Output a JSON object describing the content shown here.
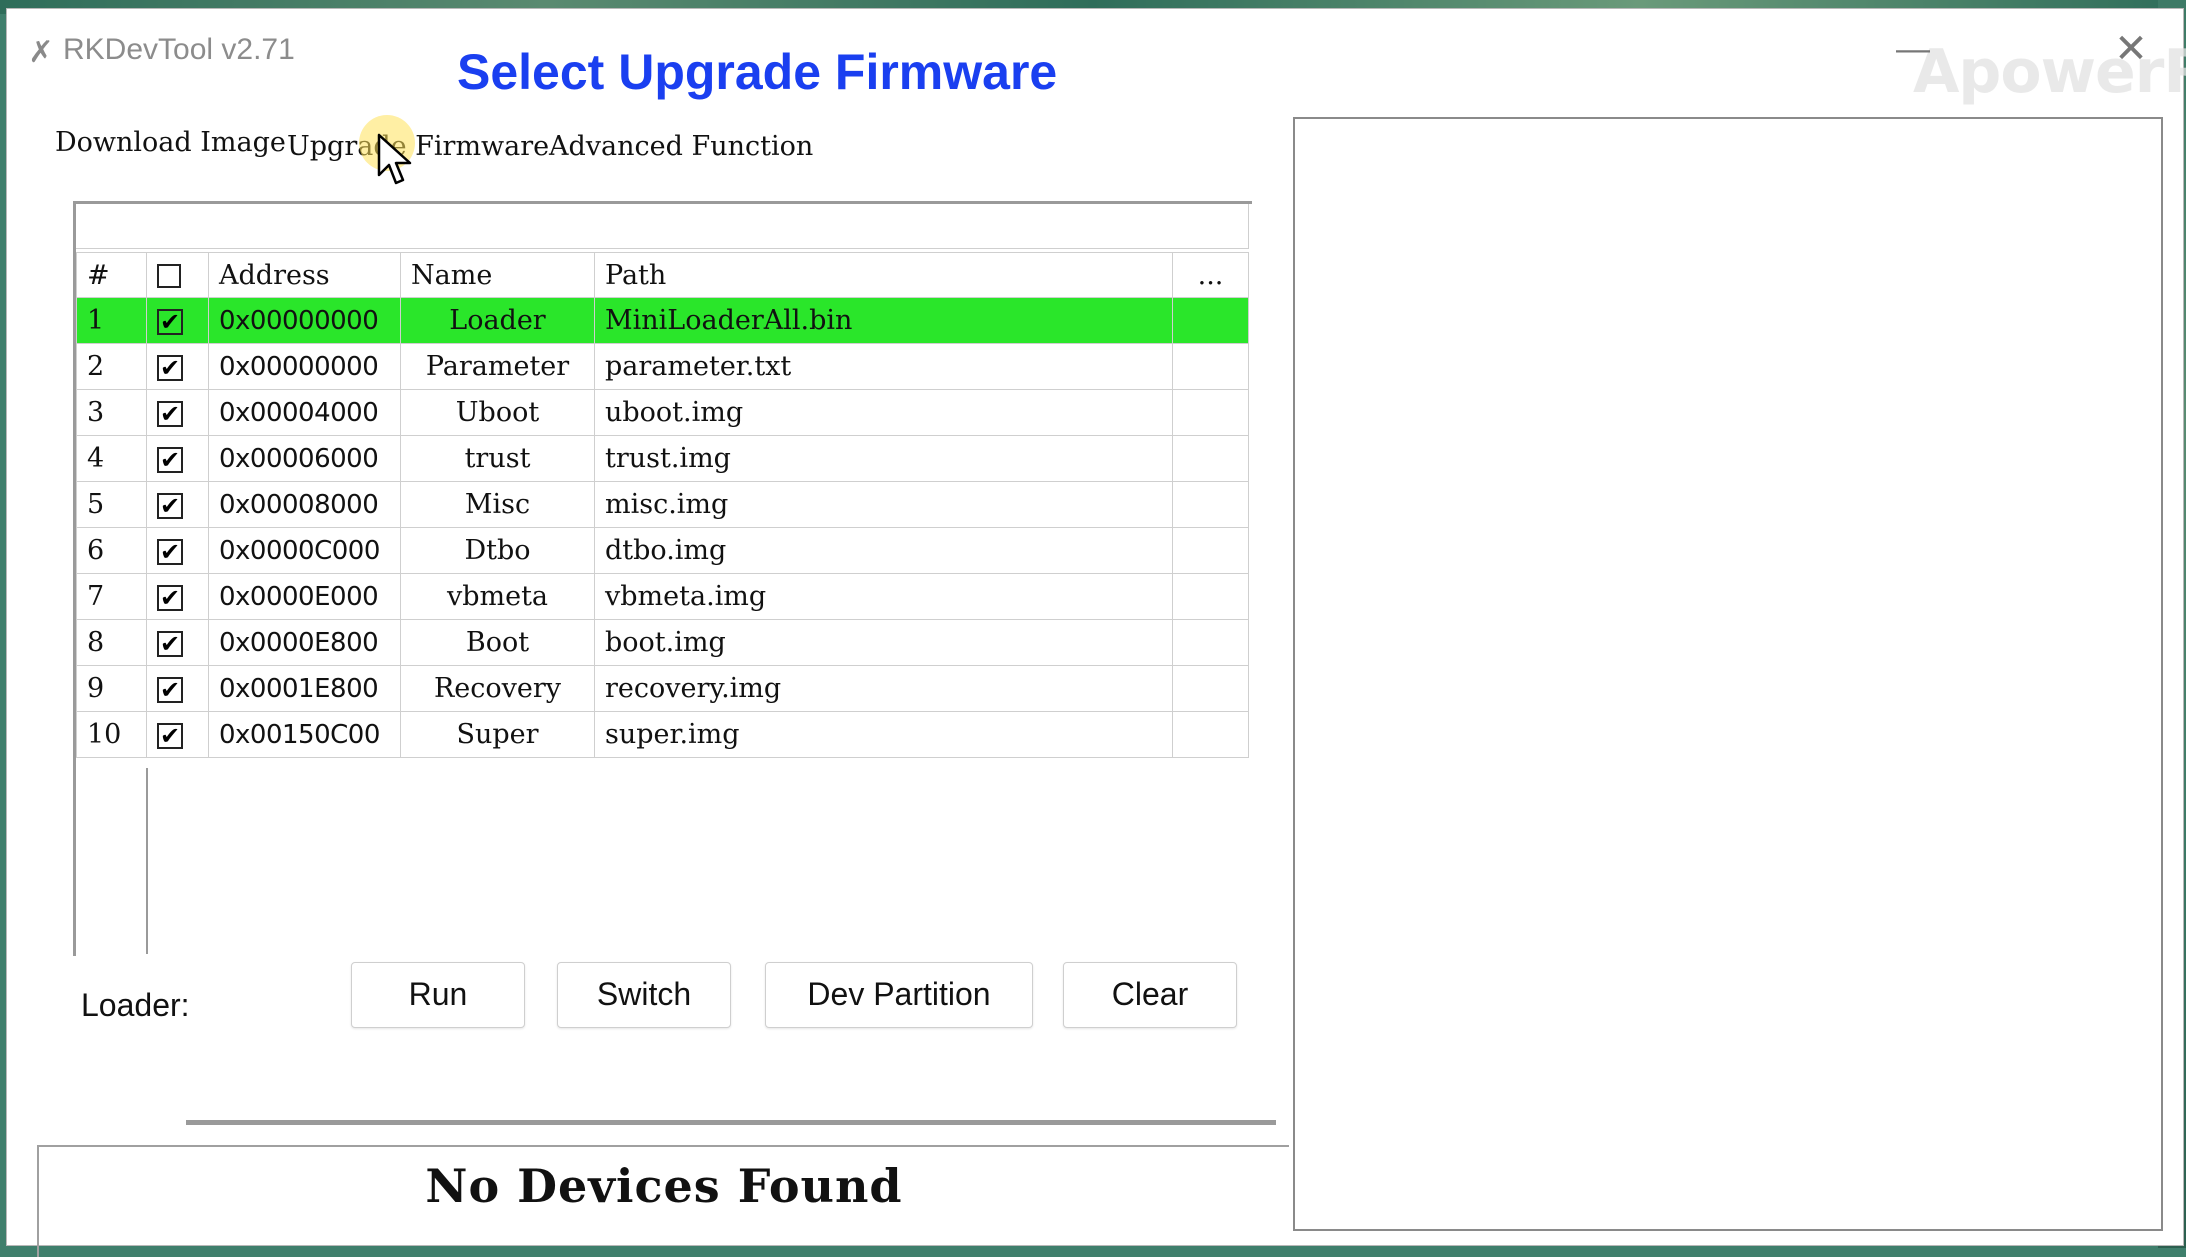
{
  "window": {
    "title": "RKDevTool v2.71",
    "caption": "Select Upgrade Firmware",
    "watermark": "ApowerREC",
    "minimize_glyph": "—",
    "close_glyph": "✕"
  },
  "tabs": [
    {
      "label": "Download Image"
    },
    {
      "label": "Upgrade Firmware"
    },
    {
      "label": "Advanced Function"
    }
  ],
  "table": {
    "columns": {
      "num": "#",
      "address": "Address",
      "name": "Name",
      "path": "Path",
      "more": "..."
    },
    "rows": [
      {
        "num": "1",
        "checked": true,
        "address": "0x00000000",
        "name": "Loader",
        "path": "MiniLoaderAll.bin",
        "selected": true
      },
      {
        "num": "2",
        "checked": true,
        "address": "0x00000000",
        "name": "Parameter",
        "path": "parameter.txt"
      },
      {
        "num": "3",
        "checked": true,
        "address": "0x00004000",
        "name": "Uboot",
        "path": "uboot.img"
      },
      {
        "num": "4",
        "checked": true,
        "address": "0x00006000",
        "name": "trust",
        "path": "trust.img"
      },
      {
        "num": "5",
        "checked": true,
        "address": "0x00008000",
        "name": "Misc",
        "path": "misc.img"
      },
      {
        "num": "6",
        "checked": true,
        "address": "0x0000C000",
        "name": "Dtbo",
        "path": "dtbo.img"
      },
      {
        "num": "7",
        "checked": true,
        "address": "0x0000E000",
        "name": "vbmeta",
        "path": "vbmeta.img"
      },
      {
        "num": "8",
        "checked": true,
        "address": "0x0000E800",
        "name": "Boot",
        "path": "boot.img"
      },
      {
        "num": "9",
        "checked": true,
        "address": "0x0001E800",
        "name": "Recovery",
        "path": "recovery.img"
      },
      {
        "num": "10",
        "checked": true,
        "address": "0x00150C00",
        "name": "Super",
        "path": "super.img"
      }
    ]
  },
  "controls": {
    "loader_label": "Loader:",
    "run": "Run",
    "switch": "Switch",
    "dev_partition": "Dev Partition",
    "clear": "Clear"
  },
  "status": {
    "text": "No Devices Found"
  },
  "colors": {
    "selected_row": "#2ae62a",
    "caption": "#1a3ff0"
  }
}
